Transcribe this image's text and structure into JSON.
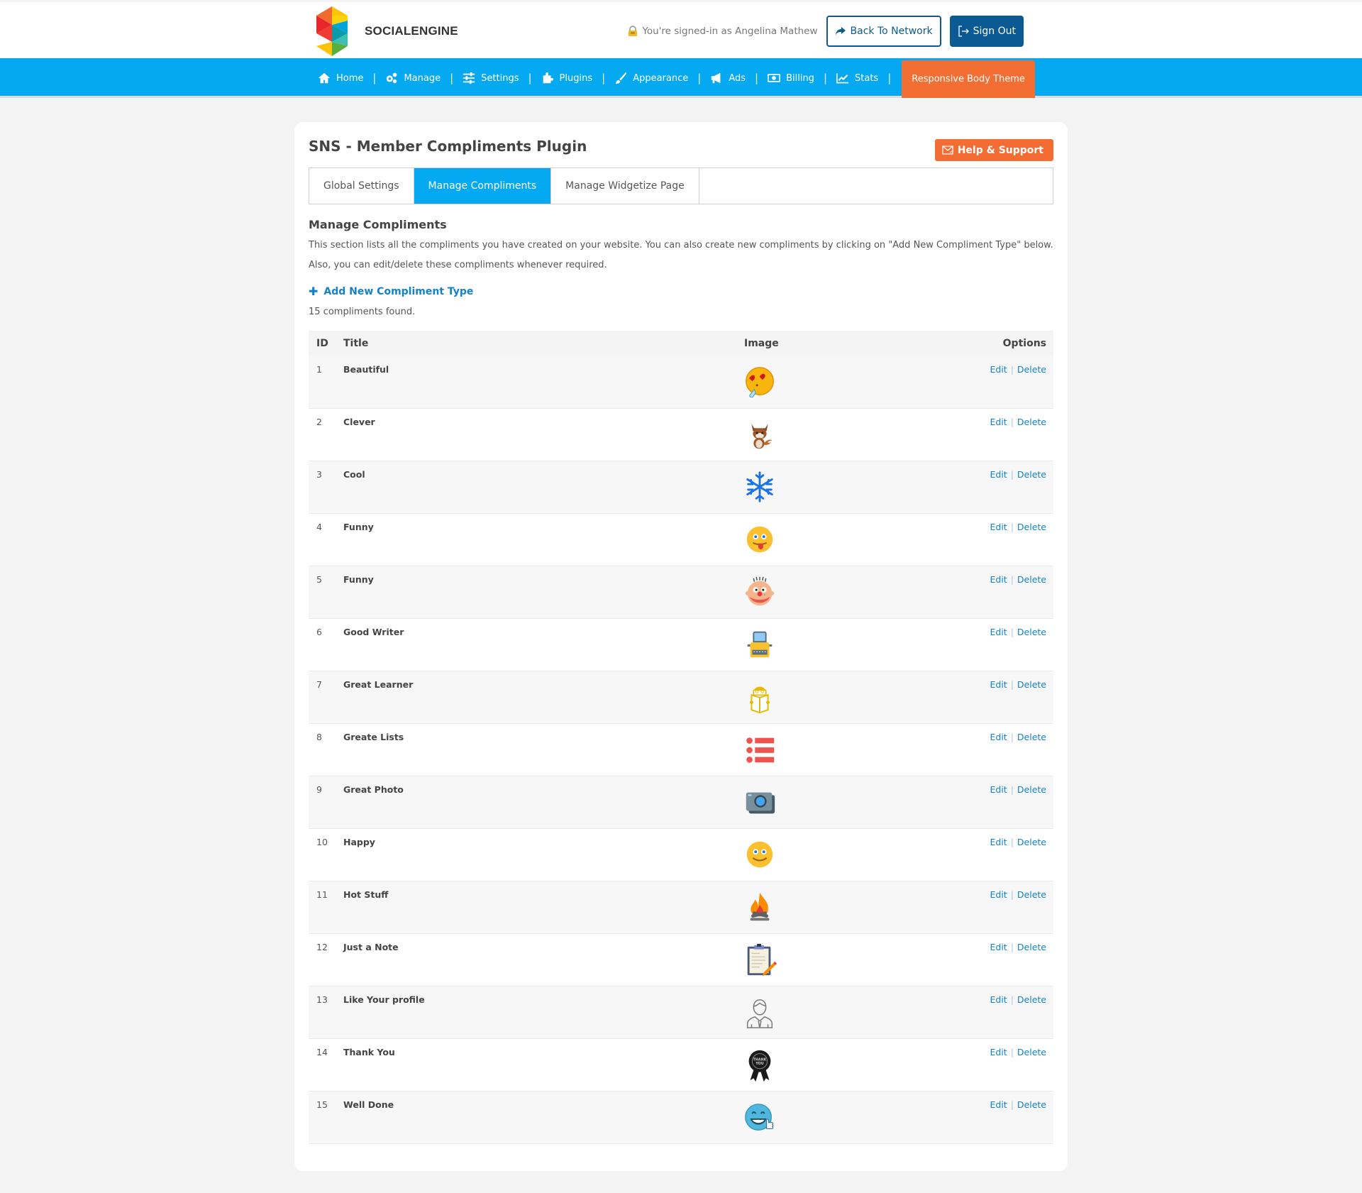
{
  "header": {
    "logo_text": "SOCIALENGINE",
    "signed_in_text": "You're signed-in as Angelina Mathew",
    "back_button": "Back To Network",
    "signout_button": "Sign Out"
  },
  "nav": {
    "items": [
      {
        "label": "Home",
        "icon": "home-icon"
      },
      {
        "label": "Manage",
        "icon": "gears-icon"
      },
      {
        "label": "Settings",
        "icon": "sliders-icon"
      },
      {
        "label": "Plugins",
        "icon": "puzzle-icon"
      },
      {
        "label": "Appearance",
        "icon": "brush-icon"
      },
      {
        "label": "Ads",
        "icon": "megaphone-icon"
      },
      {
        "label": "Billing",
        "icon": "money-icon"
      },
      {
        "label": "Stats",
        "icon": "chart-icon"
      }
    ],
    "active_item": "Responsive Body Theme"
  },
  "page": {
    "title": "SNS - Member Compliments Plugin",
    "help_button": "Help & Support",
    "tabs": [
      "Global Settings",
      "Manage Compliments",
      "Manage Widgetize Page"
    ],
    "active_tab": "Manage Compliments",
    "section_title": "Manage Compliments",
    "section_desc": "This section lists all the compliments you have created on your website. You can also create new compliments by clicking on \"Add New Compliment Type\" below. Also, you can edit/delete these compliments whenever required.",
    "add_link": "Add New Compliment Type",
    "count_text": "15 compliments found."
  },
  "table": {
    "headers": {
      "id": "ID",
      "title": "Title",
      "image": "Image",
      "options": "Options"
    },
    "edit_label": "Edit",
    "delete_label": "Delete",
    "rows": [
      {
        "id": "1",
        "title": "Beautiful",
        "image": "love-eyes-emoji-icon"
      },
      {
        "id": "2",
        "title": "Clever",
        "image": "fox-icon"
      },
      {
        "id": "3",
        "title": "Cool",
        "image": "snowflake-icon"
      },
      {
        "id": "4",
        "title": "Funny",
        "image": "tongue-emoji-icon"
      },
      {
        "id": "5",
        "title": "Funny",
        "image": "clown-icon"
      },
      {
        "id": "6",
        "title": "Good Writer",
        "image": "typewriter-icon"
      },
      {
        "id": "7",
        "title": "Great Learner",
        "image": "reader-icon"
      },
      {
        "id": "8",
        "title": "Greate Lists",
        "image": "list-icon"
      },
      {
        "id": "9",
        "title": "Great Photo",
        "image": "camera-icon"
      },
      {
        "id": "10",
        "title": "Happy",
        "image": "smile-emoji-icon"
      },
      {
        "id": "11",
        "title": "Hot Stuff",
        "image": "campfire-icon"
      },
      {
        "id": "12",
        "title": "Just a Note",
        "image": "clipboard-icon"
      },
      {
        "id": "13",
        "title": "Like Your profile",
        "image": "user-profile-icon"
      },
      {
        "id": "14",
        "title": "Thank You",
        "image": "thank-you-badge-icon"
      },
      {
        "id": "15",
        "title": "Well Done",
        "image": "thumbs-up-emoji-icon"
      }
    ]
  }
}
